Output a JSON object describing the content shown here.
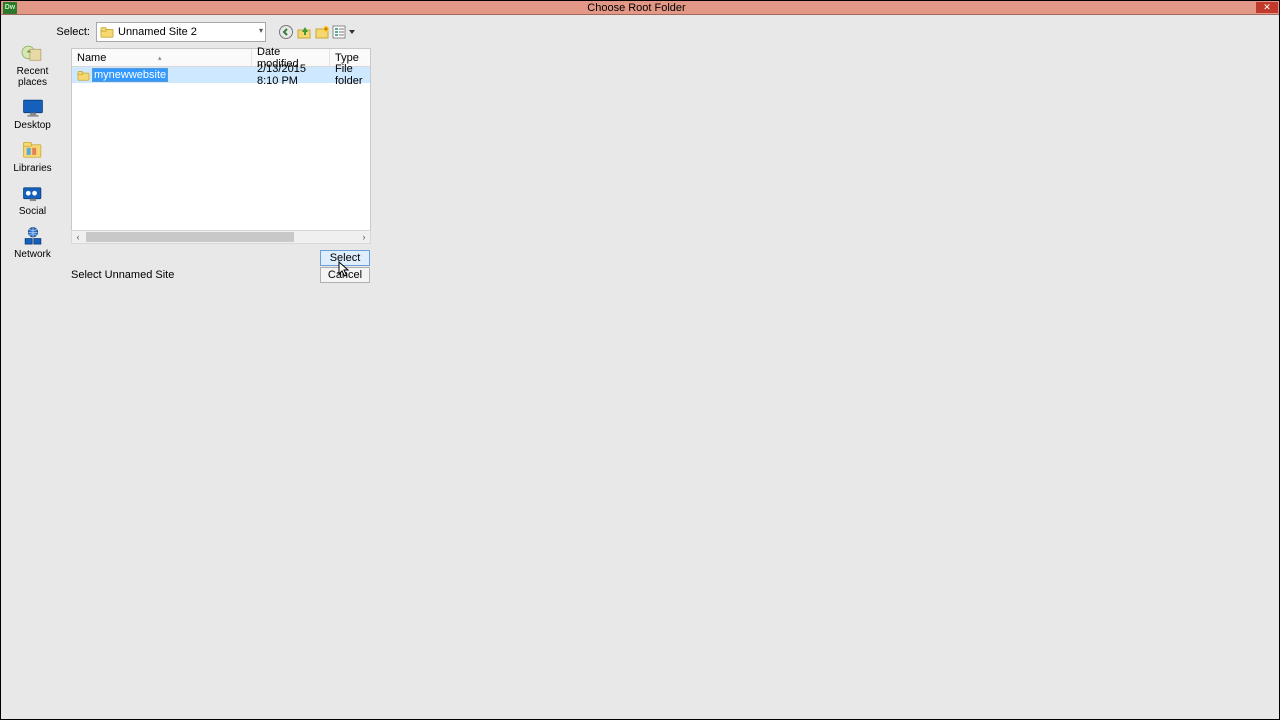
{
  "window": {
    "title": "Choose Root Folder",
    "app_icon": "Dw",
    "close": "✕"
  },
  "toolbar": {
    "select_label": "Select:",
    "path_value": "Unnamed Site 2",
    "buttons": {
      "back": "back-icon",
      "up": "up-icon",
      "newfolder": "new-folder-icon",
      "views": "views-icon"
    }
  },
  "sidebar": {
    "items": [
      {
        "label": "Recent places",
        "icon": "recent"
      },
      {
        "label": "Desktop",
        "icon": "desktop"
      },
      {
        "label": "Libraries",
        "icon": "libraries"
      },
      {
        "label": "Social",
        "icon": "social"
      },
      {
        "label": "Network",
        "icon": "network"
      }
    ]
  },
  "filelist": {
    "columns": {
      "name": "Name",
      "date": "Date modified",
      "type": "Type"
    },
    "rows": [
      {
        "name": "mynewwebsite",
        "date": "2/13/2015 8:10 PM",
        "type": "File folder",
        "editing": true
      }
    ]
  },
  "scroll": {
    "left": "‹",
    "right": "›"
  },
  "actions": {
    "select": "Select",
    "cancel": "Cancel"
  },
  "status": "Select Unnamed Site"
}
